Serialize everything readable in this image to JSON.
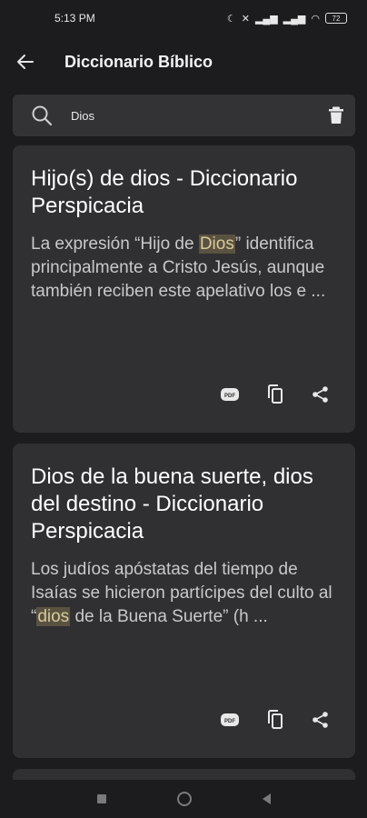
{
  "status": {
    "time": "5:13 PM",
    "battery": "72"
  },
  "appbar": {
    "title": "Diccionario Bíblico"
  },
  "search": {
    "value": "Dios"
  },
  "results": [
    {
      "title": "Hijo(s) de dios - Diccionario Perspicacia",
      "body_before": "La expresión “Hijo de ",
      "highlight": "Dios",
      "body_after": "” identifica principalmente a Cristo Jesús, aunque también reciben este apelativo los e ..."
    },
    {
      "title": "Dios de la buena suerte, dios del destino - Diccionario Perspicacia",
      "body_before": "Los judíos apóstatas del tiempo de Isaías se hicieron partícipes del culto al “",
      "highlight": "dios",
      "body_after": " de la Buena Suerte” (h ..."
    }
  ],
  "icons": {
    "back": "arrow-left-icon",
    "search": "search-icon",
    "clear": "trash-icon",
    "pdf": "pdf-icon",
    "copy": "copy-icon",
    "share": "share-icon"
  },
  "colors": {
    "background": "#1c1c1e",
    "card": "#303032",
    "highlight_bg": "#5a5240",
    "highlight_text": "#d8ca9c"
  }
}
